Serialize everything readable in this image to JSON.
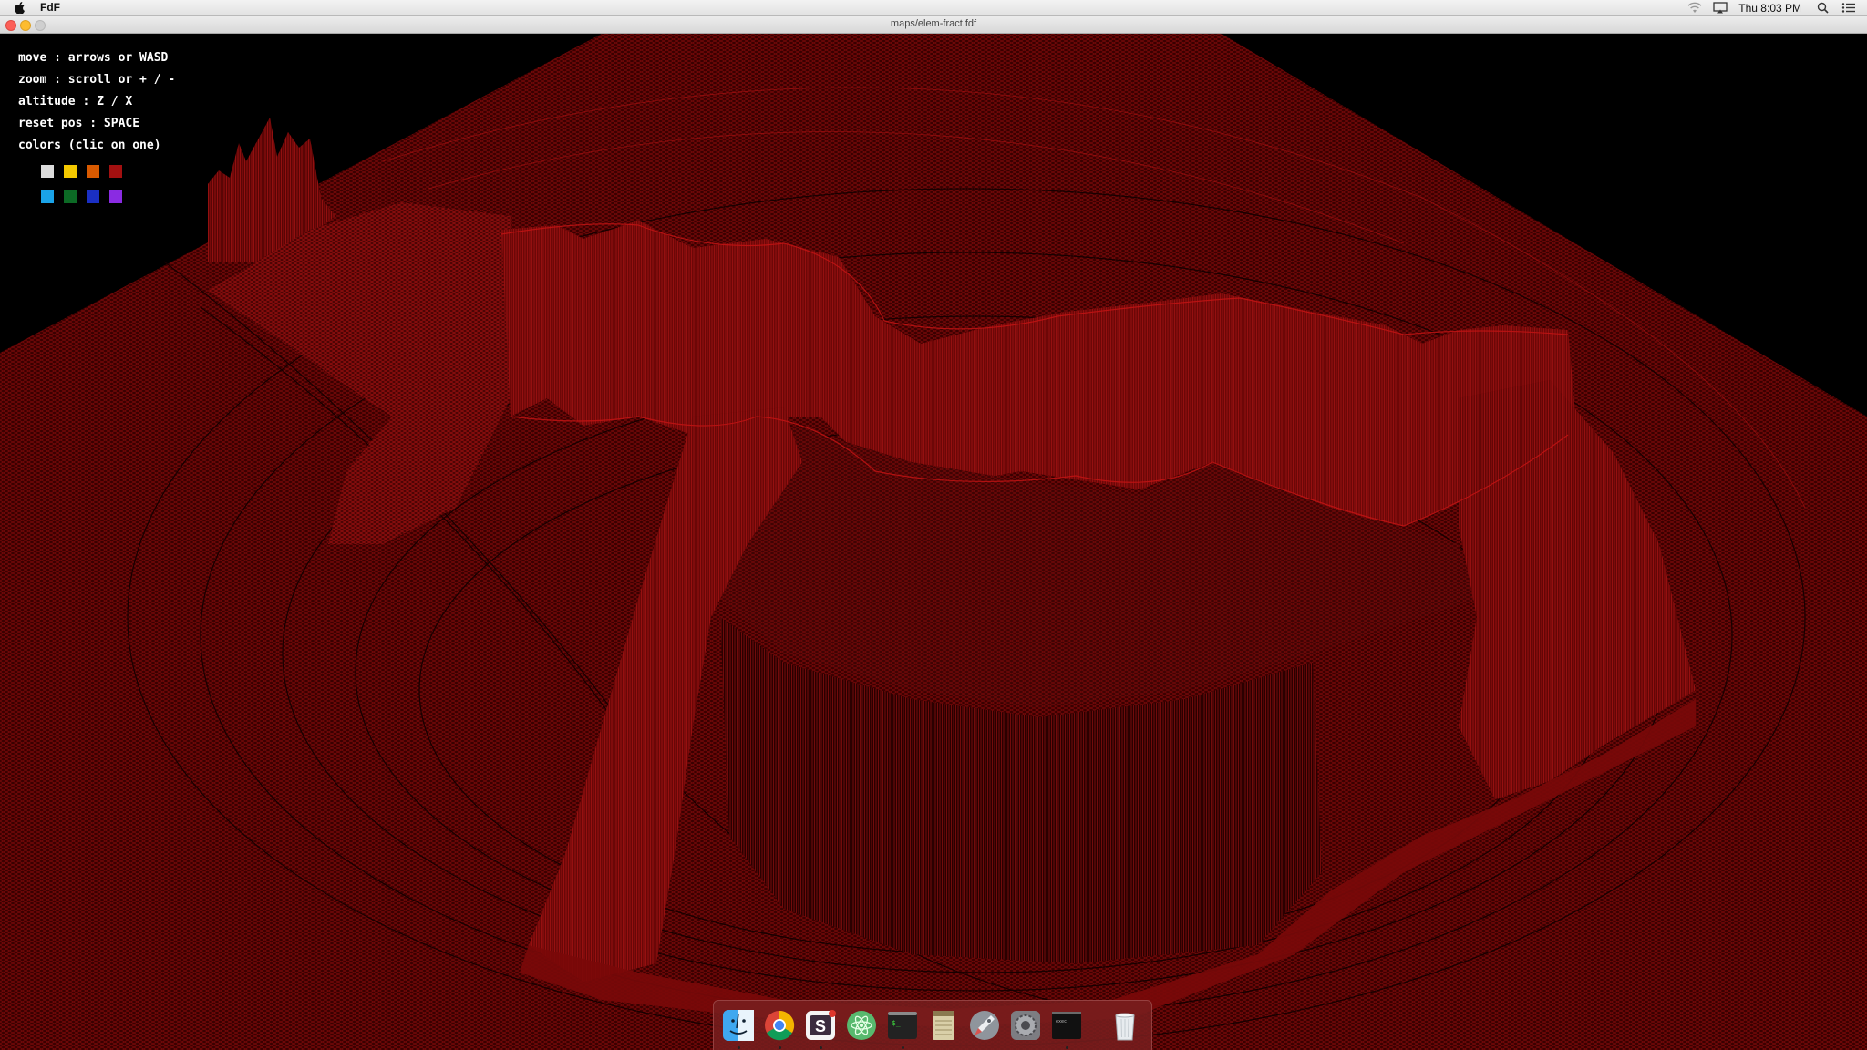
{
  "menubar": {
    "app_name": "FdF",
    "clock": "Thu 8:03 PM"
  },
  "window": {
    "title": "maps/elem-fract.fdf"
  },
  "help": {
    "move": "move : arrows or WASD",
    "zoom": "zoom : scroll or + / -",
    "altitude": "altitude : Z / X",
    "reset": "reset pos : SPACE",
    "colors": "colors (clic on one)"
  },
  "palette": {
    "selected": "red",
    "row1": [
      {
        "name": "white",
        "color": "#dcdcdc"
      },
      {
        "name": "yellow",
        "color": "#f4c900"
      },
      {
        "name": "orange",
        "color": "#d95a00"
      },
      {
        "name": "red",
        "color": "#a31010"
      }
    ],
    "row2": [
      {
        "name": "cyan",
        "color": "#1aa3e8"
      },
      {
        "name": "green",
        "color": "#0c6a25"
      },
      {
        "name": "blue",
        "color": "#1a2fc4"
      },
      {
        "name": "purple",
        "color": "#8a2be2"
      }
    ]
  },
  "wireframe": {
    "line_color": "#8a0b0b",
    "highlight_color": "#c21414"
  },
  "dock": {
    "items": [
      {
        "name": "finder-icon"
      },
      {
        "name": "chrome-icon"
      },
      {
        "name": "slack-icon"
      },
      {
        "name": "atom-icon"
      },
      {
        "name": "terminal-icon"
      },
      {
        "name": "notes-icon"
      },
      {
        "name": "launchpad-icon"
      },
      {
        "name": "system-preferences-icon"
      },
      {
        "name": "fdf-app-icon"
      },
      {
        "name": "trash-icon"
      }
    ]
  }
}
